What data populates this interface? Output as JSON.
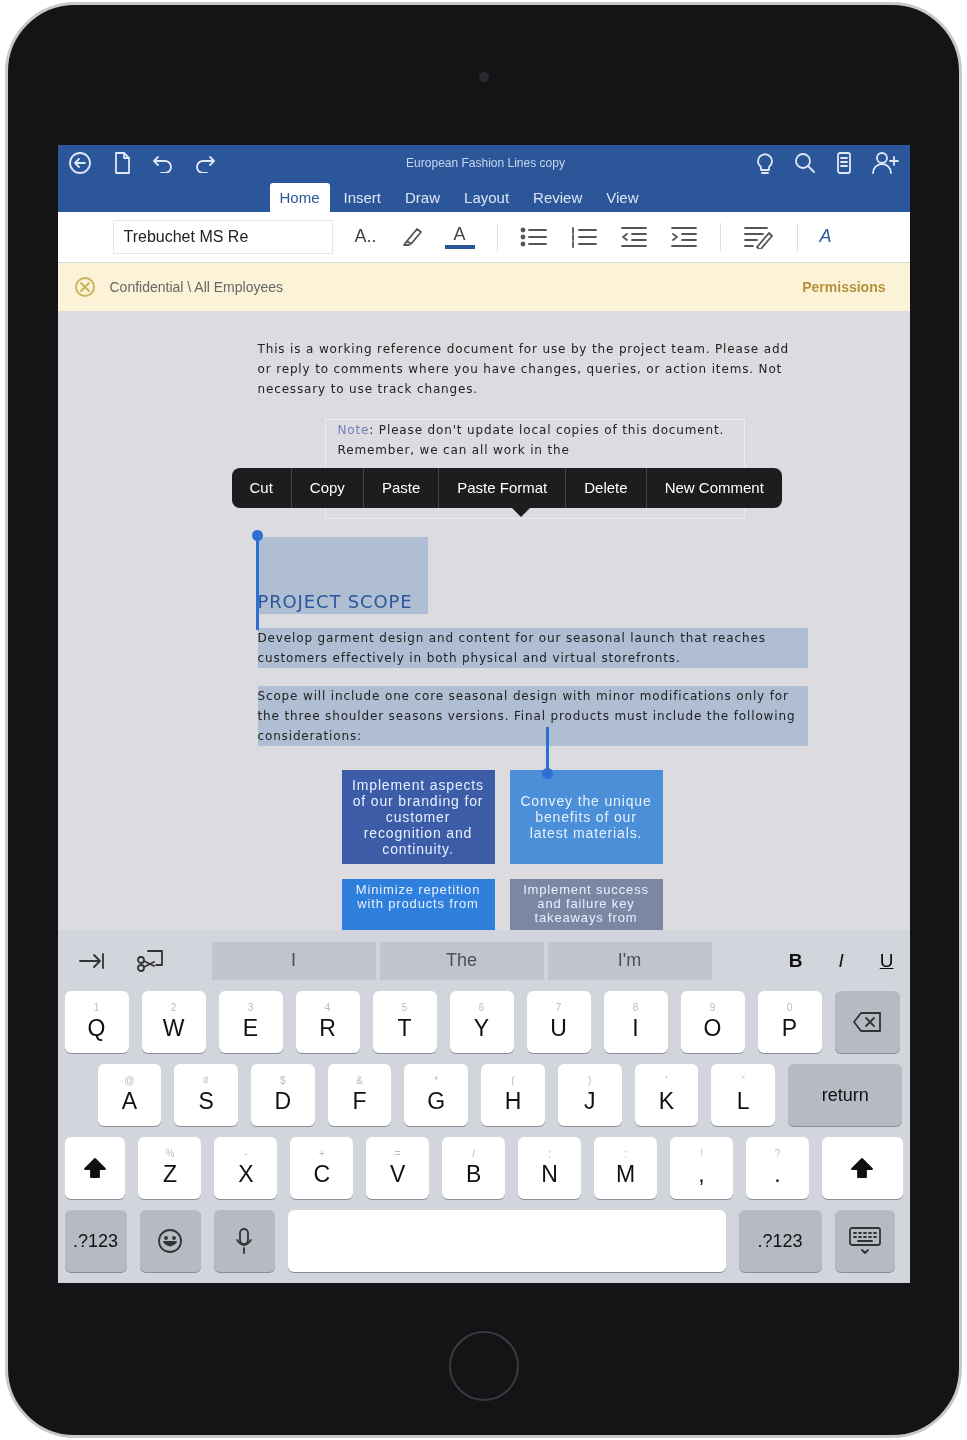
{
  "title_bar": {
    "title": "European Fashion Lines copy"
  },
  "tabs": [
    {
      "label": "Home",
      "selected": true
    },
    {
      "label": "Insert",
      "selected": false
    },
    {
      "label": "Draw",
      "selected": false
    },
    {
      "label": "Layout",
      "selected": false
    },
    {
      "label": "Review",
      "selected": false
    },
    {
      "label": "View",
      "selected": false
    }
  ],
  "ribbon": {
    "font_name": "Trebuchet MS Re",
    "font_size_glyph": "A..",
    "font_color_glyph": "A",
    "text_effects_glyph": "A"
  },
  "info_bar": {
    "label": "Confidential \\ All Employees",
    "action": "Permissions"
  },
  "document": {
    "intro": "This is a working reference document for use by the project team. Please add or reply to comments where you have changes, queries, or action items. Not necessary to use track changes.",
    "note": {
      "label": "Note",
      "text": ": Please don't update local copies of this document. Remember, we can all work in the"
    },
    "heading": {
      "text": "PROJECT SCOPE",
      "selected": true
    },
    "paragraphs": [
      {
        "text": "Develop garment design and content for our seasonal launch that reaches customers effectively in both physical and virtual storefronts.",
        "selected": true
      },
      {
        "text": "Scope will include one core seasonal design with minor modifications only for the three shoulder seasons versions.  Final products must include the following considerations:",
        "selected": true
      }
    ],
    "boxes": [
      {
        "text": "Implement aspects of our branding for customer recognition and continuity.",
        "color": "#3d5ca8"
      },
      {
        "text": "Convey the unique benefits of our latest materials.",
        "color": "#4a8fd8"
      },
      {
        "text": "Minimize repetition with products from",
        "color": "#2f7fdc"
      },
      {
        "text": "Implement success and failure key takeaways from",
        "color": "#7b88a3"
      }
    ]
  },
  "context_menu": {
    "items": [
      "Cut",
      "Copy",
      "Paste",
      "Paste Format",
      "Delete",
      "New Comment"
    ]
  },
  "keyboard": {
    "suggestions": [
      "I",
      "The",
      "I'm"
    ],
    "format_buttons": [
      "B",
      "I",
      "U"
    ],
    "rows": [
      [
        {
          "kind": "letter",
          "label": "Q",
          "hint": "1"
        },
        {
          "kind": "letter",
          "label": "W",
          "hint": "2"
        },
        {
          "kind": "letter",
          "label": "E",
          "hint": "3"
        },
        {
          "kind": "letter",
          "label": "R",
          "hint": "4"
        },
        {
          "kind": "letter",
          "label": "T",
          "hint": "5"
        },
        {
          "kind": "letter",
          "label": "Y",
          "hint": "6"
        },
        {
          "kind": "letter",
          "label": "U",
          "hint": "7"
        },
        {
          "kind": "letter",
          "label": "I",
          "hint": "8"
        },
        {
          "kind": "letter",
          "label": "O",
          "hint": "9"
        },
        {
          "kind": "letter",
          "label": "P",
          "hint": "0"
        },
        {
          "kind": "delete"
        }
      ],
      [
        {
          "kind": "letter",
          "label": "A",
          "hint": "@"
        },
        {
          "kind": "letter",
          "label": "S",
          "hint": "#"
        },
        {
          "kind": "letter",
          "label": "D",
          "hint": "$"
        },
        {
          "kind": "letter",
          "label": "F",
          "hint": "&"
        },
        {
          "kind": "letter",
          "label": "G",
          "hint": "*"
        },
        {
          "kind": "letter",
          "label": "H",
          "hint": "("
        },
        {
          "kind": "letter",
          "label": "J",
          "hint": ")"
        },
        {
          "kind": "letter",
          "label": "K",
          "hint": "'"
        },
        {
          "kind": "letter",
          "label": "L",
          "hint": "\""
        },
        {
          "kind": "return",
          "label": "return"
        }
      ],
      [
        {
          "kind": "shift"
        },
        {
          "kind": "letter",
          "label": "Z",
          "hint": "%"
        },
        {
          "kind": "letter",
          "label": "X",
          "hint": "-"
        },
        {
          "kind": "letter",
          "label": "C",
          "hint": "+"
        },
        {
          "kind": "letter",
          "label": "V",
          "hint": "="
        },
        {
          "kind": "letter",
          "label": "B",
          "hint": "/"
        },
        {
          "kind": "letter",
          "label": "N",
          "hint": ";"
        },
        {
          "kind": "letter",
          "label": "M",
          "hint": ":"
        },
        {
          "kind": "letter",
          "label": ",",
          "hint": "!"
        },
        {
          "kind": "letter",
          "label": ".",
          "hint": "?"
        },
        {
          "kind": "shift"
        }
      ]
    ],
    "bottom_row": [
      {
        "kind": "numbers",
        "label": ".?123"
      },
      {
        "kind": "emoji"
      },
      {
        "kind": "mic"
      },
      {
        "kind": "space"
      },
      {
        "kind": "numbers",
        "label": ".?123"
      },
      {
        "kind": "hide"
      }
    ]
  }
}
